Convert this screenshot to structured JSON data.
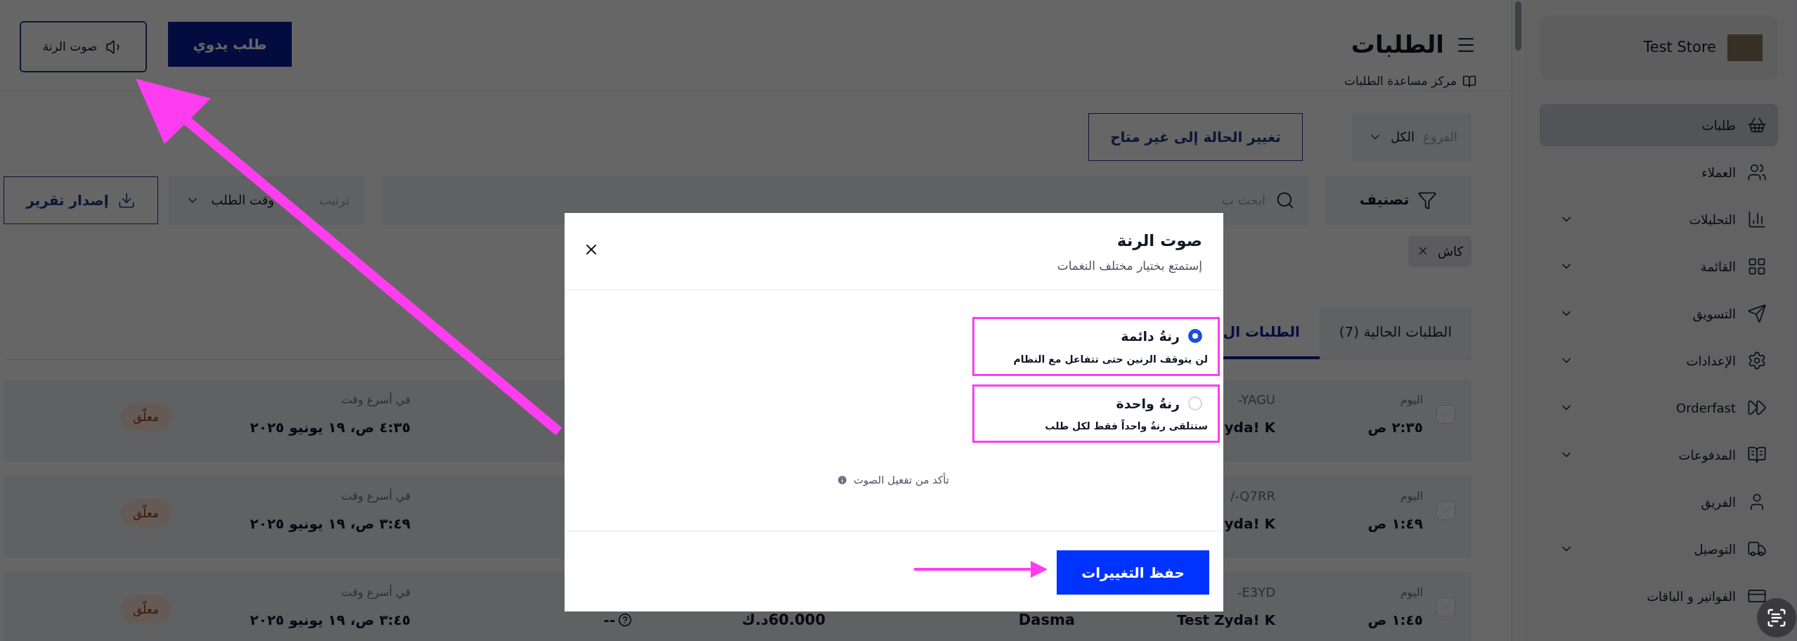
{
  "sidebar": {
    "store_name": "Test Store",
    "items": [
      {
        "label": "طلبات",
        "selected": true,
        "has_submenu": false
      },
      {
        "label": "العملاء",
        "selected": false,
        "has_submenu": false
      },
      {
        "label": "التحليلات",
        "selected": false,
        "has_submenu": true
      },
      {
        "label": "القائمة",
        "selected": false,
        "has_submenu": true
      },
      {
        "label": "التسويق",
        "selected": false,
        "has_submenu": true
      },
      {
        "label": "الإعدادات",
        "selected": false,
        "has_submenu": true
      },
      {
        "label": "Orderfast",
        "selected": false,
        "has_submenu": true
      },
      {
        "label": "المدفوعات",
        "selected": false,
        "has_submenu": true
      },
      {
        "label": "الفريق",
        "selected": false,
        "has_submenu": false
      },
      {
        "label": "التوصيل",
        "selected": false,
        "has_submenu": true
      },
      {
        "label": "الفواتير و الباقات",
        "selected": false,
        "has_submenu": false
      }
    ]
  },
  "header": {
    "title": "الطلبات",
    "help_link": "مركز مساعدة الطلبات",
    "buttons": [
      {
        "label": "طلب يدوي",
        "kind": "primary"
      },
      {
        "label": "صوت الرنة",
        "kind": "sound"
      }
    ]
  },
  "toolbar": {
    "branch_filter": {
      "label": "الفروع",
      "value": "الكل"
    },
    "status_button": "تغيير الحالة إلى غير متاح",
    "filter_button": "تصنيف",
    "search": {
      "placeholder": "ابحث ب"
    },
    "sort": {
      "label": "ترتيب",
      "value": "وقت الطلب"
    },
    "export_button": "إصدار تقرير"
  },
  "active_filters": [
    {
      "label": "كاش"
    }
  ],
  "tabs": [
    {
      "label": "الطلبات الحالية (7)",
      "selected": false
    },
    {
      "label": "الطلبات ال",
      "selected": true
    }
  ],
  "orders": [
    {
      "checked": false,
      "day": "اليوم",
      "time": "٢:٣٥ ص",
      "code": "-YAGU",
      "customer": "yda! K",
      "schedule_label": "في أسرع وقت",
      "schedule_time": "٤:٣٥ ص، ١٩ يونيو ٢٠٢٥",
      "status": "معلّق"
    },
    {
      "checked": false,
      "day": "اليوم",
      "time": "١:٤٩ ص",
      "code": "/-Q7RR",
      "customer": "yda! K",
      "schedule_label": "في أسرع وقت",
      "schedule_time": "٣:٤٩ ص، ١٩ يونيو ٢٠٢٥",
      "status": "معلّق"
    },
    {
      "checked": false,
      "day": "اليوم",
      "time": "١:٤٥ ص",
      "code": "-E3YD",
      "customer": "Test Zyda! K",
      "area": "Dasma",
      "amount": "60.000د.ك",
      "payment": "--",
      "schedule_label": "في أسرع وقت",
      "schedule_time": "٣:٤٥ ص، ١٩ يونيو ٢٠٢٥",
      "status": "معلّق"
    }
  ],
  "modal": {
    "title": "صوت الرنة",
    "subtitle": "إستمتع بختيار مختلف النغمات",
    "options": [
      {
        "title": "رنةُ دائمة",
        "description": "لن يتوقف الرنين حتى تتفاعل مع النظام",
        "selected": true
      },
      {
        "title": "رنةُ واحدة",
        "description": "ستتلقى رنةُ واحداً فقط لكل طلب",
        "selected": false
      }
    ],
    "note": "تأكد من تفعيل الصوت",
    "save_button": "حفظ التغييرات"
  }
}
